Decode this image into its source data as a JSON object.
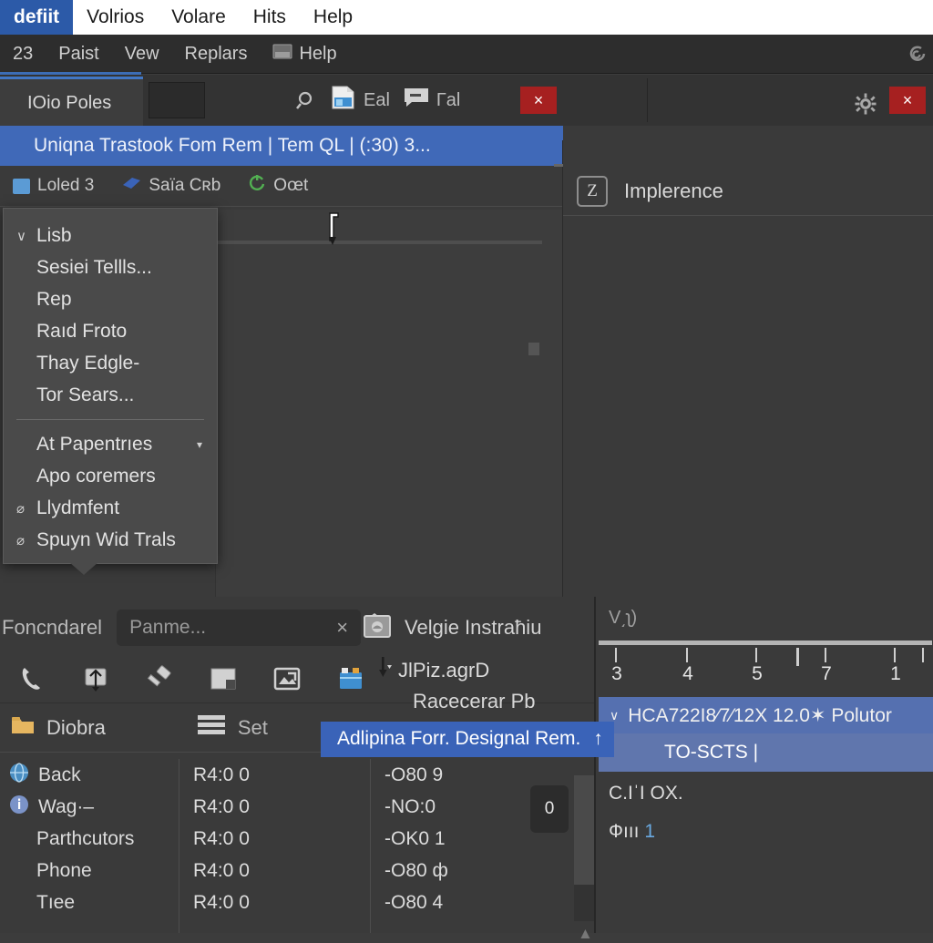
{
  "menubar": {
    "items": [
      {
        "label": "defiit",
        "selected": true
      },
      {
        "label": "Volrios",
        "selected": false
      },
      {
        "label": "Volare",
        "selected": false
      },
      {
        "label": "Hits",
        "selected": false
      },
      {
        "label": "Help",
        "selected": false
      }
    ]
  },
  "menubar2": {
    "items": [
      {
        "label": "23"
      },
      {
        "label": "Paist"
      },
      {
        "label": "Vew"
      },
      {
        "label": "Replars"
      },
      {
        "label": "Help",
        "icon": "image-icon"
      }
    ],
    "right_icon": "spiral-icon"
  },
  "tabstrip": {
    "tab_label": "IOio Poles",
    "search_icon": "search-icon",
    "items": [
      {
        "icon": "document-image-icon",
        "label": "Eal"
      },
      {
        "icon": "comment-icon",
        "label": "Гal"
      }
    ],
    "close_label": "×",
    "close2_label": "×",
    "gear_icon": "gear-icon"
  },
  "workspace": {
    "selected_title": "Uniqna Trastook Fom Rem | Tem QL | (:30) 3...",
    "chips": [
      {
        "icon": "clipboard-icon",
        "label": "Loled 3",
        "color": "#5b9bd5"
      },
      {
        "icon": "tag-icon",
        "label": "Saïa Cʀb",
        "color": "#3a63b8"
      },
      {
        "icon": "refresh-icon",
        "label": "Oœt",
        "color": "#52b052"
      }
    ],
    "right_pane": {
      "badge": "Z",
      "title": "Implerence"
    }
  },
  "dropdown": {
    "groups": [
      {
        "items": [
          {
            "label": "Lisb",
            "check": "∨"
          },
          {
            "label": "Sesiei Tellls...",
            "check": ""
          },
          {
            "label": "Rep",
            "check": ""
          },
          {
            "label": "Raıd Froto",
            "check": ""
          },
          {
            "label": "Thaу Edgle-",
            "check": ""
          },
          {
            "label": "Tor Sears...",
            "check": ""
          }
        ]
      },
      {
        "items": [
          {
            "label": "At Papentrıes",
            "check": "",
            "caret": "▾"
          },
          {
            "label": "Apo coremers",
            "check": ""
          },
          {
            "label": "Llydmfent",
            "check": "⌀"
          },
          {
            "label": "Spuyn Wid Trals",
            "check": "⌀"
          }
        ]
      }
    ]
  },
  "bottom": {
    "left_label": "Foncndarel",
    "search": {
      "placeholder": "Panme...",
      "clear": "×"
    },
    "instrument": {
      "icon": "stamp-icon",
      "label": "Velgie Instraħiu"
    },
    "tools": [
      {
        "icon": "phone-icon"
      },
      {
        "icon": "upload-icon"
      },
      {
        "icon": "hammer-icon"
      },
      {
        "icon": "window-icon"
      },
      {
        "icon": "image-export-icon"
      },
      {
        "icon": "folder-blue-icon"
      }
    ],
    "tool_right": {
      "line1": "JlPiz.agrD",
      "line2": "Racecerar Pb",
      "down_icon": "arrow-down-icon"
    },
    "folder_row": {
      "folder_icon": "folder-icon",
      "folder_label": "Diobra",
      "set_icon": "layers-icon",
      "set_label": "Set"
    },
    "tooltip": {
      "label": "Adlipina Forr. Designal Rem.",
      "caret": "↑"
    },
    "table": {
      "rows": [
        {
          "icon": "globe-icon",
          "name": "Back",
          "c2": "R4:0 0",
          "c3": "-O80 9"
        },
        {
          "icon": "info-icon",
          "name": "Wag·–",
          "c2": "R4:0 0",
          "c3": "-NO:0"
        },
        {
          "icon": "",
          "name": "Parthcutors",
          "c2": "R4:0 0",
          "c3": "-OK0 1"
        },
        {
          "icon": "",
          "name": "Phone",
          "c2": "R4:0 0",
          "c3": "-O80 ф"
        },
        {
          "icon": "",
          "name": "Tıee",
          "c2": "R4:0 0",
          "c3": "-O80 4"
        }
      ],
      "badge": "0"
    }
  },
  "right_panel": {
    "header": "V͵ʅ)",
    "ruler": {
      "ticks": [
        3,
        4,
        5,
        7,
        1
      ],
      "tick_positions": [
        18,
        96,
        172,
        248,
        324
      ],
      "extra_tick_positions": [
        217,
        355
      ]
    },
    "row1": {
      "caret": "∨",
      "label": "HCA722I8⁄7⁄12X 12.0✶ Polutor"
    },
    "row2": {
      "label": "TO-SCTS |"
    },
    "line1": "C.IˈI OX.",
    "line2_prefix": "Фııı",
    "line2_value": "1"
  },
  "colors": {
    "accent_blue": "#4069b8",
    "select_blue": "#3a63b8",
    "red_close": "#a62020",
    "panel_bg": "#3a3a3a",
    "menu_white": "#ffffff"
  }
}
